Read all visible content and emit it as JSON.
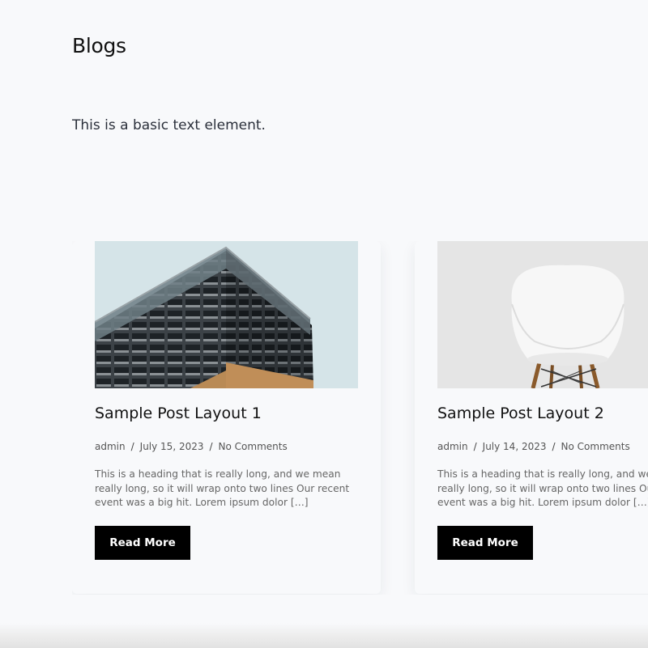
{
  "page": {
    "title": "Blogs",
    "intro": "This is a basic text element."
  },
  "posts": [
    {
      "title": "Sample Post Layout 1",
      "author": "admin",
      "date": "July 15, 2023",
      "comments": "No Comments",
      "excerpt": "This is a heading that is really long, and we mean really long, so it will wrap onto two lines Our recent event was a big hit. Lorem ipsum dolor […]",
      "button": "Read More",
      "image": "building-facade-photo"
    },
    {
      "title": "Sample Post Layout 2",
      "author": "admin",
      "date": "July 14, 2023",
      "comments": "No Comments",
      "excerpt": "This is a heading that is really long, and we mean really long, so it will wrap onto two lines Our recent event was a big hit. Lorem ipsum dolor […]",
      "button": "Read More",
      "image": "white-chair-photo"
    }
  ],
  "meta": {
    "separator": "/"
  },
  "colors": {
    "background": "#f8f9fb",
    "button": "#000000",
    "button_text": "#ffffff"
  }
}
